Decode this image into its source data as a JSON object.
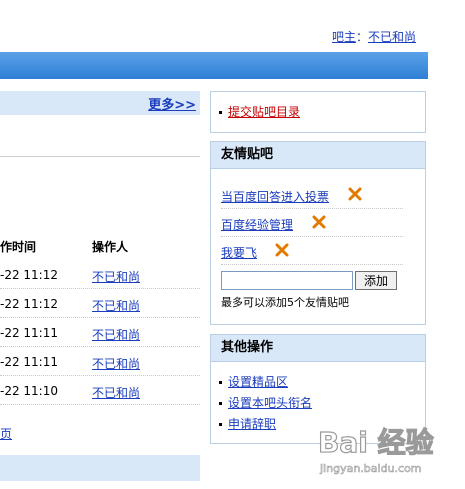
{
  "header": {
    "owner_label": "吧主",
    "separator": "：",
    "owner_name": "不已和尚"
  },
  "log": {
    "more_link": "更多>>",
    "col_time": "作时间",
    "col_operator": "操作人",
    "rows": [
      {
        "time": "-22 11:12",
        "operator": "不已和尚"
      },
      {
        "time": "-22 11:12",
        "operator": "不已和尚"
      },
      {
        "time": "-22 11:11",
        "operator": "不已和尚"
      },
      {
        "time": "-22 11:11",
        "operator": "不已和尚"
      },
      {
        "time": "-22 11:10",
        "operator": "不已和尚"
      }
    ],
    "page_link": "页"
  },
  "submit_panel": {
    "link": "提交贴吧目录"
  },
  "friend_panel": {
    "title": "友情贴吧",
    "items": [
      {
        "name": "当百度回答进入投票"
      },
      {
        "name": "百度经验管理"
      },
      {
        "name": "我要飞"
      }
    ],
    "input_value": "",
    "add_button": "添加",
    "hint": "最多可以添加5个友情贴吧"
  },
  "other_panel": {
    "title": "其他操作",
    "items": [
      {
        "label": "设置精品区"
      },
      {
        "label": "设置本吧头衔名"
      },
      {
        "label": "申请辞职"
      }
    ]
  },
  "watermark": {
    "text": "Bai 经验",
    "url": "jingyan.baidu.com"
  },
  "colors": {
    "header_bar": "#2f7fd6",
    "panel_title_bg": "#d8e8f8",
    "link": "#1a3cbd",
    "submit_link": "#c40000",
    "delete_icon": "#e07a00"
  }
}
